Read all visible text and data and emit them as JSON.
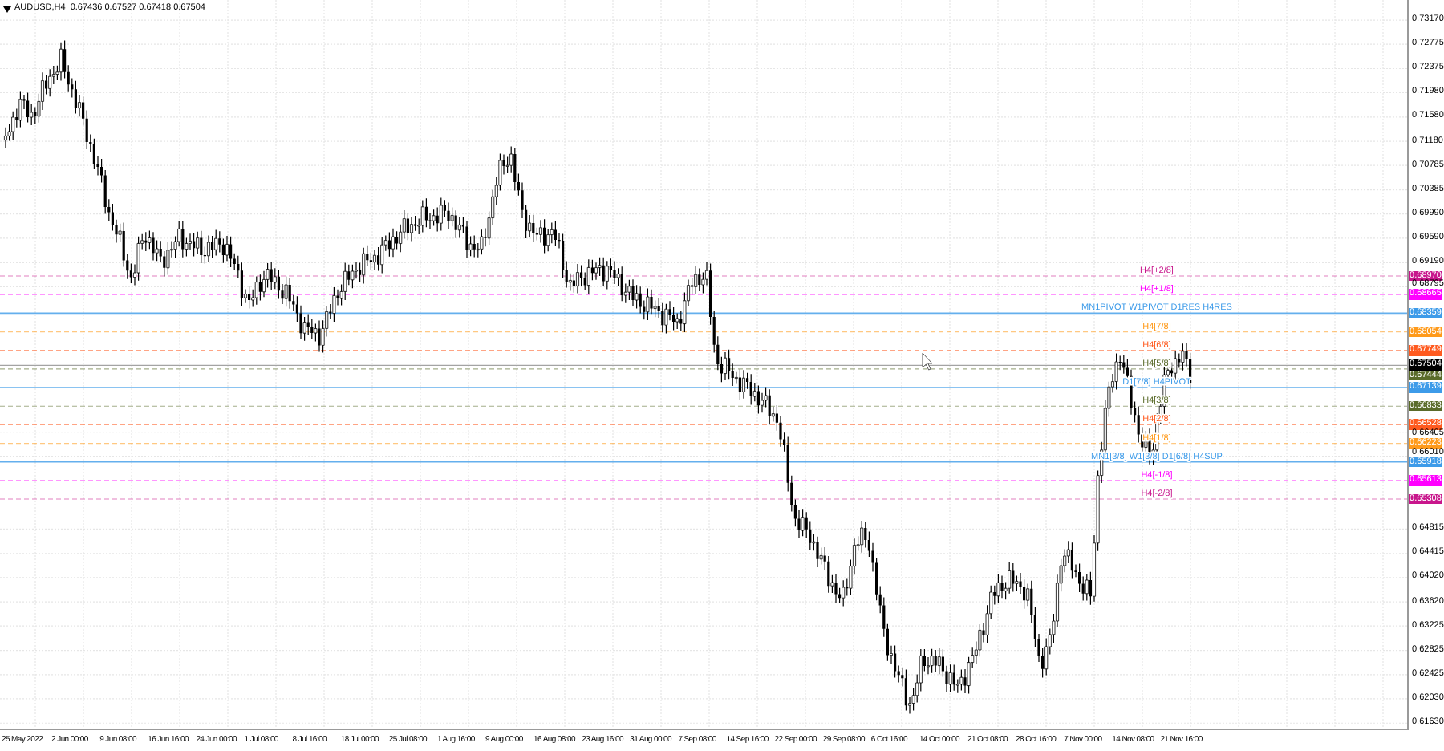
{
  "header": {
    "text": "AUDUSD,H4  0.67436 0.67527 0.67418 0.67504"
  },
  "price_axis": {
    "labels": [
      "0.73170",
      "0.72775",
      "0.72375",
      "0.71980",
      "0.71580",
      "0.71180",
      "0.70785",
      "0.70385",
      "0.69990",
      "0.69590",
      "0.69190",
      "0.68795",
      "0.66405",
      "0.66010",
      "0.64815",
      "0.64415",
      "0.64020",
      "0.63620",
      "0.63225",
      "0.62825",
      "0.62425",
      "0.62030",
      "0.61630"
    ]
  },
  "levels": [
    {
      "label": "H4[+2/8]",
      "price_tag": "0.68970",
      "color": "#c8168c",
      "kind": "dashed"
    },
    {
      "label": "H4[+1/8]",
      "price_tag": "0.68665",
      "color": "#ff00ff",
      "kind": "dashed"
    },
    {
      "label": "MN1PIVOT W1PIVOT D1RES H4RES",
      "price_tag": "0.68359",
      "color": "#3d9be9",
      "kind": "solid"
    },
    {
      "label": "H4[7/8]",
      "price_tag": "0.68054",
      "color": "#ff9a1a",
      "kind": "dashed"
    },
    {
      "label": "H4[6/8]",
      "price_tag": "0.67749",
      "color": "#ff5a1f",
      "kind": "dashed"
    },
    {
      "label": "H4[5/8]",
      "price_tag": "0.67444",
      "color": "#5a6b2a",
      "kind": "dashed"
    },
    {
      "label": "D1[7/8] H4PIVOT",
      "price_tag": "0.67139",
      "color": "#3d9be9",
      "kind": "solid"
    },
    {
      "label": "H4[3/8]",
      "price_tag": "0.66833",
      "color": "#5a6b2a",
      "kind": "dashed"
    },
    {
      "label": "H4[2/8]",
      "price_tag": "0.66528",
      "color": "#ff5a1f",
      "kind": "dashed"
    },
    {
      "label": "H4[1/8]",
      "price_tag": "0.66223",
      "color": "#ff9a1a",
      "kind": "dashed"
    },
    {
      "label": "MN1[3/8] W1[3/8] D1[6/8] H4SUP",
      "price_tag": "0.65918",
      "color": "#3d9be9",
      "kind": "solid"
    },
    {
      "label": "H4[-1/8]",
      "price_tag": "0.65613",
      "color": "#ff00ff",
      "kind": "dashed"
    },
    {
      "label": "H4[-2/8]",
      "price_tag": "0.65308",
      "color": "#c8168c",
      "kind": "dashed"
    }
  ],
  "current_price": {
    "tag": "0.67504"
  },
  "time_axis": {
    "labels": [
      "25 May 2022",
      "2 Jun 00:00",
      "9 Jun 08:00",
      "16 Jun 16:00",
      "24 Jun 00:00",
      "1 Jul 08:00",
      "8 Jul 16:00",
      "18 Jul 00:00",
      "25 Jul 08:00",
      "1 Aug 16:00",
      "9 Aug 00:00",
      "16 Aug 08:00",
      "23 Aug 16:00",
      "31 Aug 00:00",
      "7 Sep 08:00",
      "14 Sep 16:00",
      "22 Sep 00:00",
      "29 Sep 08:00",
      "6 Oct 16:00",
      "14 Oct 00:00",
      "21 Oct 08:00",
      "28 Oct 16:00",
      "7 Nov 00:00",
      "14 Nov 08:00",
      "21 Nov 16:00"
    ]
  }
}
